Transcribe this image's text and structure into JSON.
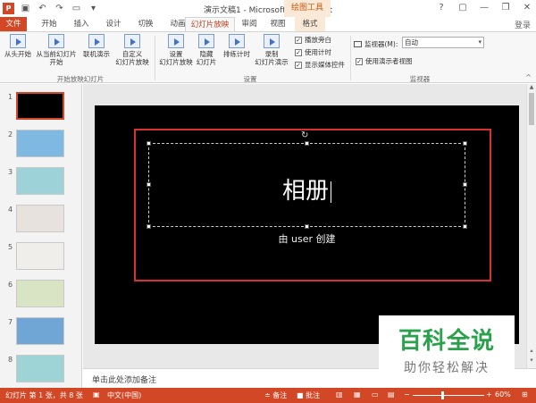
{
  "window": {
    "doc_title": "演示文稿1 - Microsoft PowerPoint",
    "context_title": "绘图工具",
    "help": "?",
    "minimize": "—",
    "restore": "❐",
    "close": "✕",
    "login": "登录"
  },
  "tabs": [
    {
      "label": "文件"
    },
    {
      "label": "开始"
    },
    {
      "label": "插入"
    },
    {
      "label": "设计"
    },
    {
      "label": "切换"
    },
    {
      "label": "动画"
    },
    {
      "label": "幻灯片放映"
    },
    {
      "label": "审阅"
    },
    {
      "label": "视图"
    },
    {
      "label": "格式"
    }
  ],
  "ribbon": {
    "from_start": "从头开始",
    "from_current_1": "从当前幻灯片",
    "from_current_2": "开始",
    "online_present": "联机演示",
    "custom_show_1": "自定义",
    "custom_show_2": "幻灯片放映",
    "group_start": "开始放映幻灯片",
    "setup_show_1": "设置",
    "setup_show_2": "幻灯片放映",
    "hide_slide_1": "隐藏",
    "hide_slide_2": "幻灯片",
    "rehearse": "排练计时",
    "record_1": "录制",
    "record_2": "幻灯片演示",
    "group_setup": "设置",
    "play_narrations": "播放旁白",
    "use_timings": "使用计时",
    "show_media": "显示媒体控件",
    "monitor_label": "监视器(M):",
    "monitor_value": "自动",
    "presenter_view": "使用演示者视图",
    "group_monitors": "监视器"
  },
  "thumbnails": [
    {
      "num": "1",
      "bg": "#000000"
    },
    {
      "num": "2",
      "bg": "#7fb8e0"
    },
    {
      "num": "3",
      "bg": "#9dd3d8"
    },
    {
      "num": "4",
      "bg": "#e8e2de"
    },
    {
      "num": "5",
      "bg": "#f0eeea"
    },
    {
      "num": "6",
      "bg": "#d9e4c4"
    },
    {
      "num": "7",
      "bg": "#6fa6d6"
    },
    {
      "num": "8",
      "bg": "#9fd4d6"
    }
  ],
  "slide": {
    "title": "相册",
    "subtitle": "由 user 创建"
  },
  "notes": {
    "placeholder": "单击此处添加备注"
  },
  "status": {
    "slide_info": "幻灯片 第 1 张，共 8 张",
    "language": "中文(中国)",
    "notes": "备注",
    "comments": "批注",
    "zoom": "60%"
  },
  "watermark": {
    "title": "百科全说",
    "subtitle": "助你轻松解决"
  },
  "colors": {
    "accent": "#d24726",
    "selection": "#d63230",
    "watermark": "#2aa14b"
  }
}
